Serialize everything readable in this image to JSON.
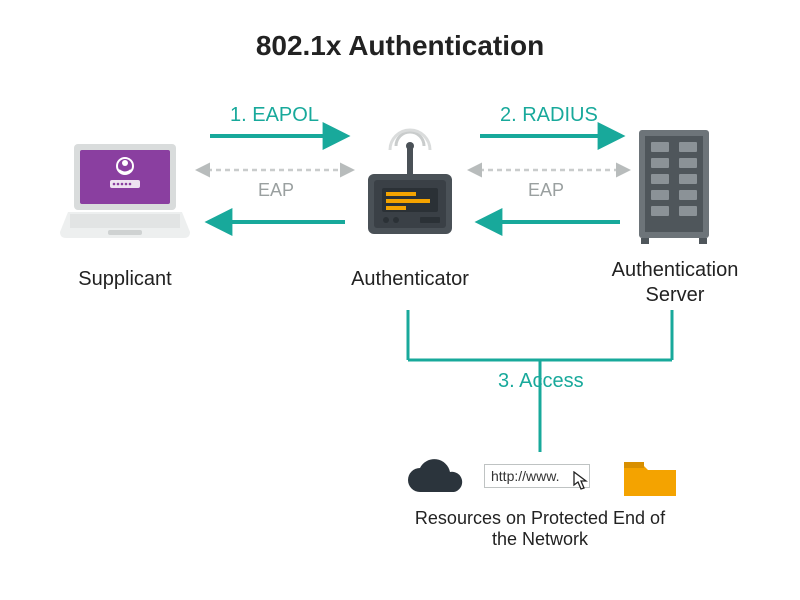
{
  "title": "802.1x Authentication",
  "nodes": {
    "supplicant": "Supplicant",
    "authenticator": "Authenticator",
    "auth_server": "Authentication Server"
  },
  "flows": {
    "eapol": "1. EAPOL",
    "radius": "2. RADIUS",
    "access": "3. Access",
    "eap_left": "EAP",
    "eap_right": "EAP"
  },
  "resources": {
    "url_text": "http://www.",
    "caption": "Resources on Protected End of the Network"
  },
  "colors": {
    "teal": "#18a99b",
    "dark": "#2b343c",
    "orange": "#f4a300",
    "grey": "#9aa0a0",
    "purple": "#8a3fa0"
  }
}
